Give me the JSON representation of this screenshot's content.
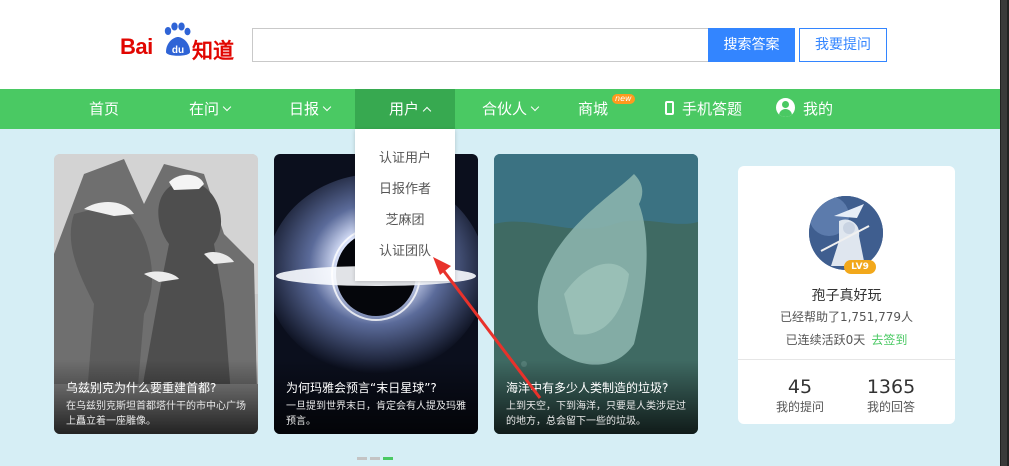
{
  "header": {
    "logo_bai": "Bai",
    "logo_du": "du",
    "logo_zhidao": "知道",
    "search_value": "",
    "search_button": "搜索答案",
    "ask_button": "我要提问"
  },
  "nav": {
    "items": [
      {
        "label": "首页"
      },
      {
        "label": "在问"
      },
      {
        "label": "日报"
      },
      {
        "label": "用户"
      },
      {
        "label": "合伙人"
      },
      {
        "label": "商城",
        "badge": "new"
      },
      {
        "label": "手机答题"
      },
      {
        "label": "我的"
      }
    ]
  },
  "dropdown": {
    "items": [
      "认证用户",
      "日报作者",
      "芝麻团",
      "认证团队"
    ]
  },
  "cards": [
    {
      "title": "乌兹别克为什么要重建首都?",
      "desc": "在乌兹别克斯坦首都塔什干的市中心广场上矗立着一座雕像。"
    },
    {
      "title": "为何玛雅会预言“末日星球”?",
      "desc": "一旦提到世界末日，肯定会有人提及玛雅预言。"
    },
    {
      "title": "海洋中有多少人类制造的垃圾?",
      "desc": "上到天空，下到海洋，只要是人类涉足过的地方，总会留下一些的垃圾。"
    }
  ],
  "user_panel": {
    "level": "LV9",
    "name": "孢子真好玩",
    "helped": "已经帮助了1,751,779人",
    "streak": "已连续活跃0天",
    "sign_in": "去签到",
    "questions_count": "45",
    "questions_label": "我的提问",
    "answers_count": "1365",
    "answers_label": "我的回答"
  },
  "colors": {
    "nav_green": "#4ac963",
    "brand_red": "#e10601",
    "search_blue": "#3385ff",
    "hero_bg": "#d6eef5",
    "annotation_arrow": "#e8322b"
  }
}
